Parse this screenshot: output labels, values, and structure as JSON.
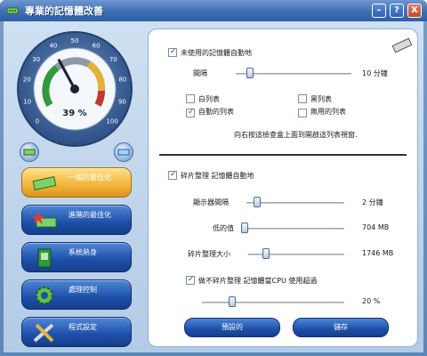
{
  "window": {
    "title": "專業的記憶體改善",
    "buttons": {
      "minimize": "–",
      "help": "?",
      "close": "X"
    }
  },
  "gauge": {
    "percent_label": "39 %",
    "value": 0.39,
    "ticks": [
      "0",
      "10",
      "20",
      "30",
      "40",
      "50",
      "60",
      "70",
      "80",
      "90",
      "100"
    ]
  },
  "nav": {
    "items": [
      {
        "label": "一般的最佳化",
        "active": true
      },
      {
        "label": "進階的最佳化",
        "active": false
      },
      {
        "label": "系統熱身",
        "active": false
      },
      {
        "label": "處理控制",
        "active": false
      },
      {
        "label": "程式設定",
        "active": false
      }
    ]
  },
  "section1": {
    "auto_label": "未使用的記憶體自動地",
    "auto_checked": true,
    "interval_label": "間隔",
    "interval_value": "10 分鐘",
    "interval_level": 0.1,
    "options": [
      {
        "label": "白列表",
        "checked": false
      },
      {
        "label": "黑列表",
        "checked": false
      },
      {
        "label": "自動的列表",
        "checked": true
      },
      {
        "label": "無用的列表",
        "checked": false
      }
    ],
    "hint": "向右按這檢查盒上面到開啟這列表視窗."
  },
  "section2": {
    "defrag_label": "碎片整理 記憶體自動地",
    "defrag_checked": true,
    "display_interval_label": "顯示器間隔",
    "display_interval_value": "2 分鐘",
    "display_interval_level": 0.08,
    "low_value_label": "低的值",
    "low_value_value": "704 MB",
    "low_value_level": 0.0,
    "defrag_size_label": "碎片整理大小",
    "defrag_size_value": "1746 MB",
    "defrag_size_level": 0.16,
    "cpu_label": "做不碎片整理 記憶體當CPU 使用超過",
    "cpu_checked": true,
    "cpu_value": "20 %",
    "cpu_level": 0.2
  },
  "actions": {
    "default_label": "預設的",
    "save_label": "儲存"
  },
  "colors": {
    "accent": "#2f5fa6",
    "active_nav": "#f3b43a",
    "gauge_green": "#2e9a3a",
    "gauge_red": "#c0392b"
  }
}
